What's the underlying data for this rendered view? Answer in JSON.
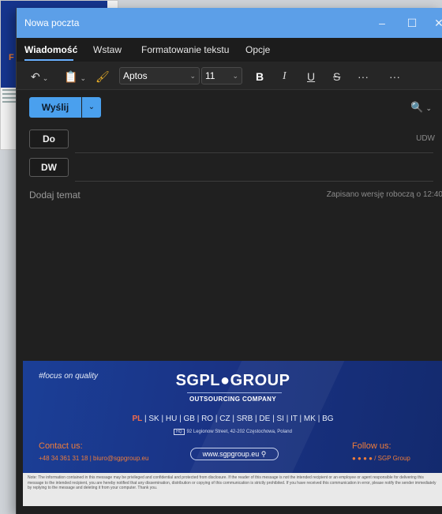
{
  "window": {
    "title": "Nowa poczta"
  },
  "tabs": [
    "Wiadomość",
    "Wstaw",
    "Formatowanie tekstu",
    "Opcje"
  ],
  "ribbon": {
    "undo_icon": "undo-icon",
    "clipboard_icon": "clipboard-icon",
    "format_painter_icon": "format-painter-icon",
    "font_name": "Aptos",
    "font_size": "11",
    "bold": "B",
    "italic": "I",
    "underline": "U",
    "strikethrough": "S",
    "more1": "···",
    "more2": "···"
  },
  "compose": {
    "send_label": "Wyślij",
    "to_label": "Do",
    "cc_label": "DW",
    "bcc_label": "UDW",
    "subject_placeholder": "Dodaj temat",
    "draft_status": "Zapisano wersję roboczą o 12:40"
  },
  "signature": {
    "tagline": "#focus on quality",
    "logo": "SGPL●GROUP",
    "logo_sub": "OUTSOURCING COMPANY",
    "countries_pl": "PL",
    "countries_rest": " | SK | HU | GB | RO | CZ | SRB | DE | SI | IT | MK | BG",
    "address_tag": "HQ",
    "address": "92 Legionow Street, 42-202 Częstochowa, Poland",
    "contact_title": "Contact us:",
    "contact_line": "+48 34 361 31 18  |  biuro@sgpgroup.eu",
    "website": "www.sgpgroup.eu",
    "follow_title": "Follow us:",
    "follow_line": "● ● ● ●  / SGP Group"
  },
  "note": "Note: The information contained in this message may be privileged and confidential and protected from disclosure. If the reader of this message is not the intended recipient or an employee or agent responsible for delivering this message to the intended recipient, you are hereby notified that any dissemination, distribution or copying of this communication is strictly prohibited. If you have received this communication in error, please notify the sender immediately by replying to the message and deleting it from your computer. Thank you.",
  "colors": {
    "accent": "#4aa0ee",
    "titlebar": "#5c9fe8",
    "banner": "#1a3385",
    "orange": "#f07d3a"
  }
}
